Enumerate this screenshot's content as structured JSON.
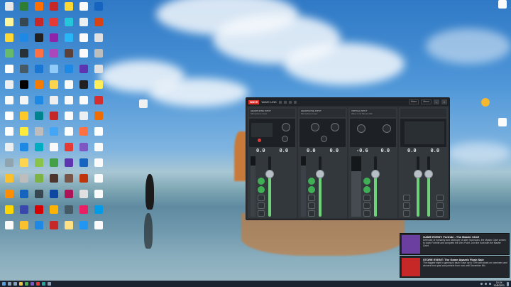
{
  "desktop": {
    "icon_colors": [
      "#e8e8e8",
      "#2e7d32",
      "#ff6f00",
      "#c62828",
      "#fdd835",
      "#fafafa",
      "#1565c0",
      "#fff59d",
      "#37474f",
      "#c62828",
      "#e53935",
      "#26c6da",
      "#eceff1",
      "#d84315",
      "#fdd835",
      "#1e88e5",
      "#212121",
      "#8e24aa",
      "#29b6f6",
      "#fafafa",
      "#e0e0e0",
      "#66bb6a",
      "#263238",
      "#ff7043",
      "#ab47bc",
      "#5d4037",
      "#fafafa",
      "#bdbdbd",
      "#fff",
      "#455a64",
      "#1976d2",
      "#90caf9",
      "#1e88e5",
      "#5e35b1",
      "#e0e0e0",
      "#eceff1",
      "#000",
      "#f57c00",
      "#ffd54f",
      "#fafafa",
      "#212121",
      "#ffee58",
      "#fafafa",
      "#f5f5f5",
      "#1e88e5",
      "#eeeeee",
      "#fafafa",
      "#fafafa",
      "#d32f2f",
      "#fff",
      "#ffca28",
      "#00838f",
      "#c62828",
      "#fafafa",
      "#eceff1",
      "#ef6c00",
      "#fff",
      "#ffeb3b",
      "#bdbdbd",
      "#42a5f5",
      "#fff",
      "#ff7043",
      "#fff",
      "#eceff1",
      "#1e88e5",
      "#00acc1",
      "#fafafa",
      "#e53935",
      "#7e57c2",
      "#fafafa",
      "#90a4ae",
      "#ffd54f",
      "#8bc34a",
      "#43a047",
      "#5e35b1",
      "#1565c0",
      "#fafafa",
      "#fbc02d",
      "#bdbdbd",
      "#7cb342",
      "#4e342e",
      "#795548",
      "#bf360c",
      "#fafafa",
      "#ff8f00",
      "#1565c0",
      "#37474f",
      "#0d47a1",
      "#ad1457",
      "#e0e0e0",
      "#fafafa",
      "#ffd600",
      "#3949ab",
      "#d50000",
      "#ffb300",
      "#455a64",
      "#e91e63",
      "#039be5",
      "#fafafa",
      "#fbc02d",
      "#1e88e5",
      "#c62828",
      "#ffe082",
      "#2196f3",
      "#fafafa"
    ]
  },
  "mixer": {
    "logo": "WAVE",
    "app_title": "WAVE LINK",
    "header_button_1": "Mixer",
    "header_button_2": "Menu",
    "channels": [
      {
        "name": "HEADPHONE INPUT",
        "sub": "Microphone Input",
        "val_left": "0.0",
        "val_right": "0.0"
      },
      {
        "name": "HEADPHONE INPUT",
        "sub": "Microphone Input",
        "val_left": "0.0",
        "val_right": "0.0"
      },
      {
        "name": "VIRTUAL INPUT",
        "sub": "Wave Link Stream Mix",
        "val_left": "-0.6",
        "val_right": "0.0"
      },
      {
        "name": "",
        "sub": "",
        "val_left": "0.0",
        "val_right": "0.0"
      }
    ]
  },
  "notifications": [
    {
      "title": "GAME EVENT: Fortnite - The Master Chief",
      "body": "Defender of humanity and destroyer of alien incursions, the Master Chief arrives to claim Fortnite and complete the Zero Point. Join the hunt with the Master Chief.",
      "color": "#6a3fa0"
    },
    {
      "title": "STORE EVENT: The Game Awards Flash Sale",
      "body": "The biggest night in gaming is back! Save up to 70% with deals on nominees and winners from past and present from now until December 6th.",
      "color": "#c62828"
    }
  ],
  "taskbar": {
    "time": "10:24",
    "date": "12/8/2021"
  }
}
